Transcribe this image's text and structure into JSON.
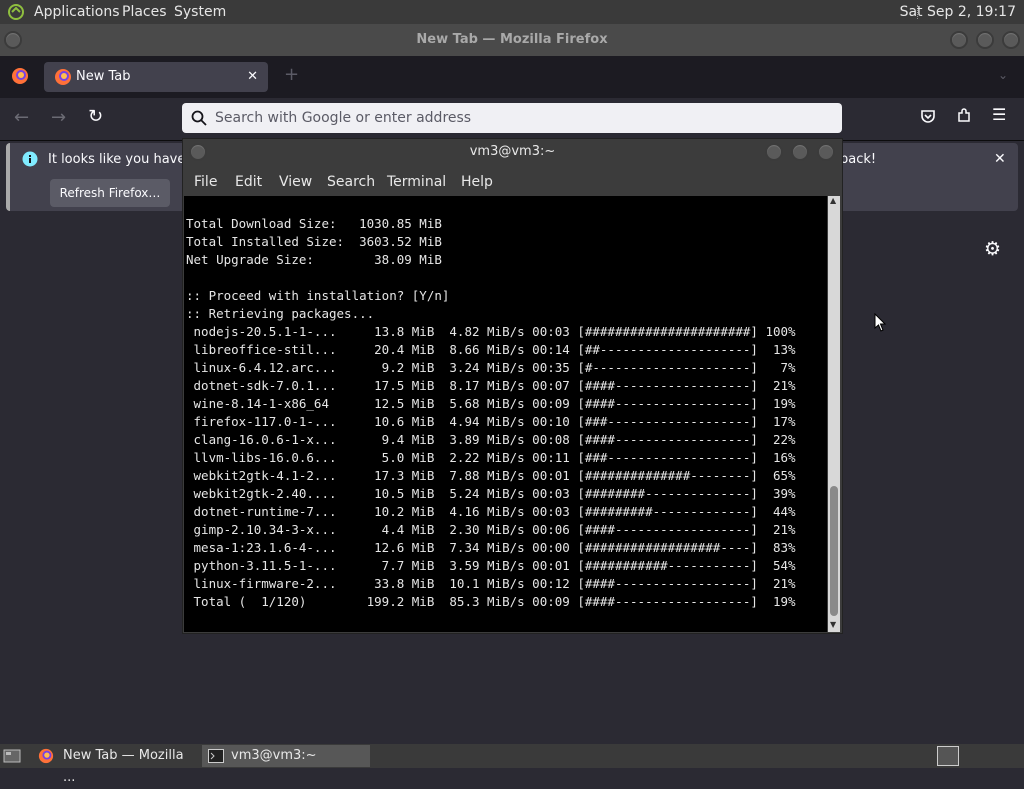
{
  "panel": {
    "menus": [
      "Applications",
      "Places",
      "System"
    ],
    "clock": "Sat Sep  2, 19:17"
  },
  "firefox": {
    "window_title": "New Tab — Mozilla Firefox",
    "tab_label": "New Tab",
    "tab_close": "✕",
    "new_tab": "+",
    "url_placeholder": "Search with Google or enter address",
    "notification_text": "It looks like you haven't",
    "notification_text_end": "back!",
    "refresh_button": "Refresh Firefox…"
  },
  "terminal": {
    "title": "vm3@vm3:~",
    "menus": [
      "File",
      "Edit",
      "View",
      "Search",
      "Terminal",
      "Help"
    ],
    "lines": [
      "Total Download Size:   1030.85 MiB",
      "Total Installed Size:  3603.52 MiB",
      "Net Upgrade Size:        38.09 MiB",
      "",
      ":: Proceed with installation? [Y/n]",
      ":: Retrieving packages...",
      " nodejs-20.5.1-1-...     13.8 MiB  4.82 MiB/s 00:03 [######################] 100%",
      " libreoffice-stil...     20.4 MiB  8.66 MiB/s 00:14 [##--------------------]  13%",
      " linux-6.4.12.arc...      9.2 MiB  3.24 MiB/s 00:35 [#---------------------]   7%",
      " dotnet-sdk-7.0.1...     17.5 MiB  8.17 MiB/s 00:07 [####------------------]  21%",
      " wine-8.14-1-x86_64      12.5 MiB  5.68 MiB/s 00:09 [####------------------]  19%",
      " firefox-117.0-1-...     10.6 MiB  4.94 MiB/s 00:10 [###-------------------]  17%",
      " clang-16.0.6-1-x...      9.4 MiB  3.89 MiB/s 00:08 [####------------------]  22%",
      " llvm-libs-16.0.6...      5.0 MiB  2.22 MiB/s 00:11 [###-------------------]  16%",
      " webkit2gtk-4.1-2...     17.3 MiB  7.88 MiB/s 00:01 [##############--------]  65%",
      " webkit2gtk-2.40....     10.5 MiB  5.24 MiB/s 00:03 [########--------------]  39%",
      " dotnet-runtime-7...     10.2 MiB  4.16 MiB/s 00:03 [#########-------------]  44%",
      " gimp-2.10.34-3-x...      4.4 MiB  2.30 MiB/s 00:06 [####------------------]  21%",
      " mesa-1:23.1.6-4-...     12.6 MiB  7.34 MiB/s 00:00 [##################----]  83%",
      " python-3.11.5-1-...      7.7 MiB  3.59 MiB/s 00:01 [###########-----------]  54%",
      " linux-firmware-2...     33.8 MiB  10.1 MiB/s 00:12 [####------------------]  21%",
      " Total (  1/120)        199.2 MiB  85.3 MiB/s 00:09 [####------------------]  19%"
    ]
  },
  "taskbar": {
    "items": [
      "New Tab — Mozilla ...",
      "vm3@vm3:~"
    ]
  }
}
